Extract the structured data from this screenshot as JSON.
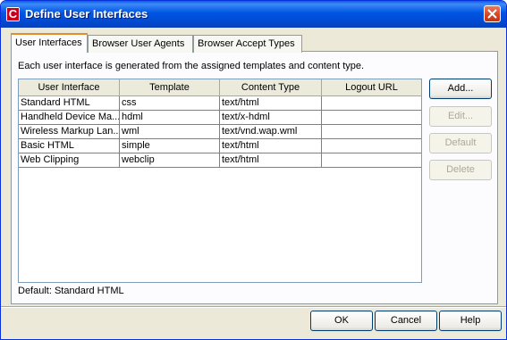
{
  "window": {
    "title": "Define User Interfaces",
    "icon_letter": "C"
  },
  "tabs": [
    "User Interfaces",
    "Browser User Agents",
    "Browser Accept Types"
  ],
  "description": "Each user interface is generated from the assigned templates and content type.",
  "table": {
    "columns": [
      "User Interface",
      "Template",
      "Content Type",
      "Logout URL"
    ],
    "rows": [
      [
        "Standard HTML",
        "css",
        "text/html",
        ""
      ],
      [
        "Handheld Device Ma...",
        "hdml",
        "text/x-hdml",
        ""
      ],
      [
        "Wireless Markup Lan...",
        "wml",
        "text/vnd.wap.wml",
        ""
      ],
      [
        "Basic HTML",
        "simple",
        "text/html",
        ""
      ],
      [
        "Web Clipping",
        "webclip",
        "text/html",
        ""
      ]
    ]
  },
  "side_buttons": {
    "add": "Add...",
    "edit": "Edit...",
    "default": "Default",
    "delete": "Delete"
  },
  "default_label": "Default:  Standard HTML",
  "footer_buttons": {
    "ok": "OK",
    "cancel": "Cancel",
    "help": "Help"
  }
}
